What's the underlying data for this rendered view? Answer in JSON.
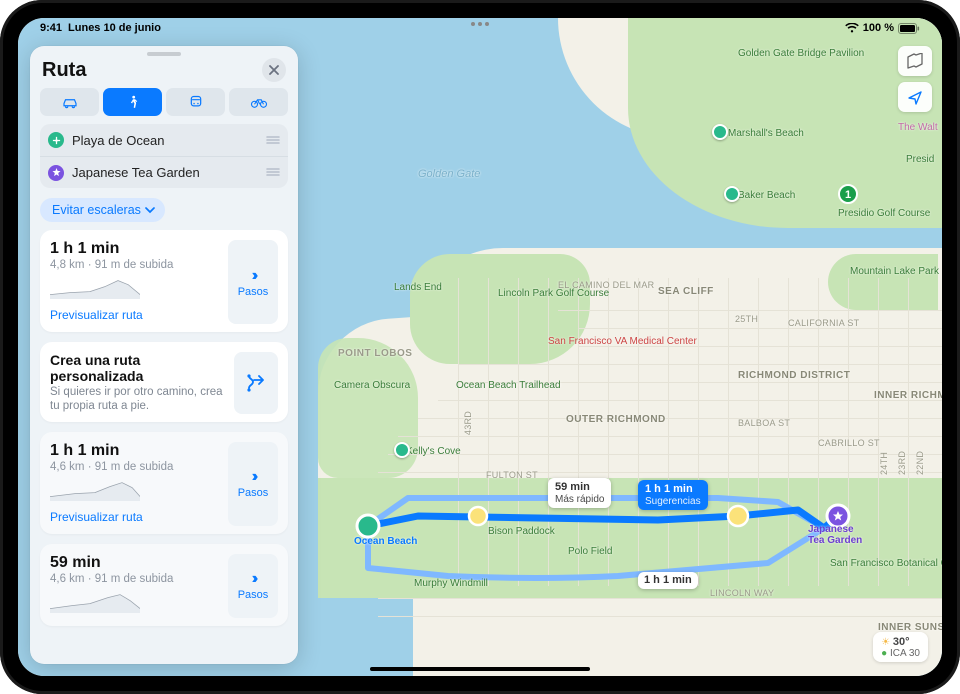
{
  "status": {
    "time": "9:41",
    "date": "Lunes 10 de junio",
    "battery_label": "100 %"
  },
  "panel": {
    "title": "Ruta",
    "modes": [
      "car",
      "walk",
      "transit",
      "bike"
    ],
    "active_mode_index": 1,
    "origin": "Playa de Ocean",
    "destination": "Japanese Tea Garden",
    "avoid_chip_label": "Evitar escaleras",
    "custom_route": {
      "title": "Crea una ruta personalizada",
      "desc": "Si quieres ir por otro camino, crea tu propia ruta a pie."
    },
    "action_label": "Pasos",
    "preview_label": "Previsualizar ruta",
    "routes": [
      {
        "duration": "1 h 1 min",
        "meta": "4,8 km · 91 m de subida"
      },
      {
        "duration": "1 h 1 min",
        "meta": "4,6 km · 91 m de subida"
      },
      {
        "duration": "59 min",
        "meta": "4,6 km · 91 m de subida"
      }
    ]
  },
  "map": {
    "route_badges": {
      "fastest": {
        "time": "59 min",
        "sub": "Más rápido"
      },
      "suggested": {
        "time": "1 h 1 min",
        "sub": "Sugerencias"
      },
      "alt": {
        "time": "1 h 1 min"
      }
    },
    "origin_poi": "Ocean Beach",
    "destination_poi": "Japanese\nTea Garden",
    "water_label": "Golden\nGate",
    "districts": [
      "SEA CLIFF",
      "OUTER RICHMOND",
      "RICHMOND DISTRICT",
      "INNER RICHMOND",
      "INNER SUNSET"
    ],
    "streets": [
      "EL CAMINO DEL MAR",
      "CALIFORNIA ST",
      "BALBOA ST",
      "CABRILLO ST",
      "FULTON ST",
      "LINCOLN WAY",
      "43RD",
      "25TH",
      "24TH",
      "23RD",
      "22ND"
    ],
    "pois": [
      "Golden Gate Bridge Pavilion",
      "Marshall's Beach",
      "Baker Beach",
      "Presidio Golf Course",
      "Mountain Lake Park",
      "Lincoln Park Golf Course",
      "Lands End",
      "Point Lobos",
      "Camera Obscura",
      "Kelly's Cove",
      "Ocean Beach Trailhead",
      "San Francisco VA Medical Center",
      "Bison Paddock",
      "Polo Field",
      "Murphy Windmill",
      "San Francisco Botanical Garden",
      "The Walt",
      "Presid"
    ],
    "weather": {
      "temp": "30°",
      "aqi_label": "ICA 30"
    },
    "shield_value": "1"
  }
}
